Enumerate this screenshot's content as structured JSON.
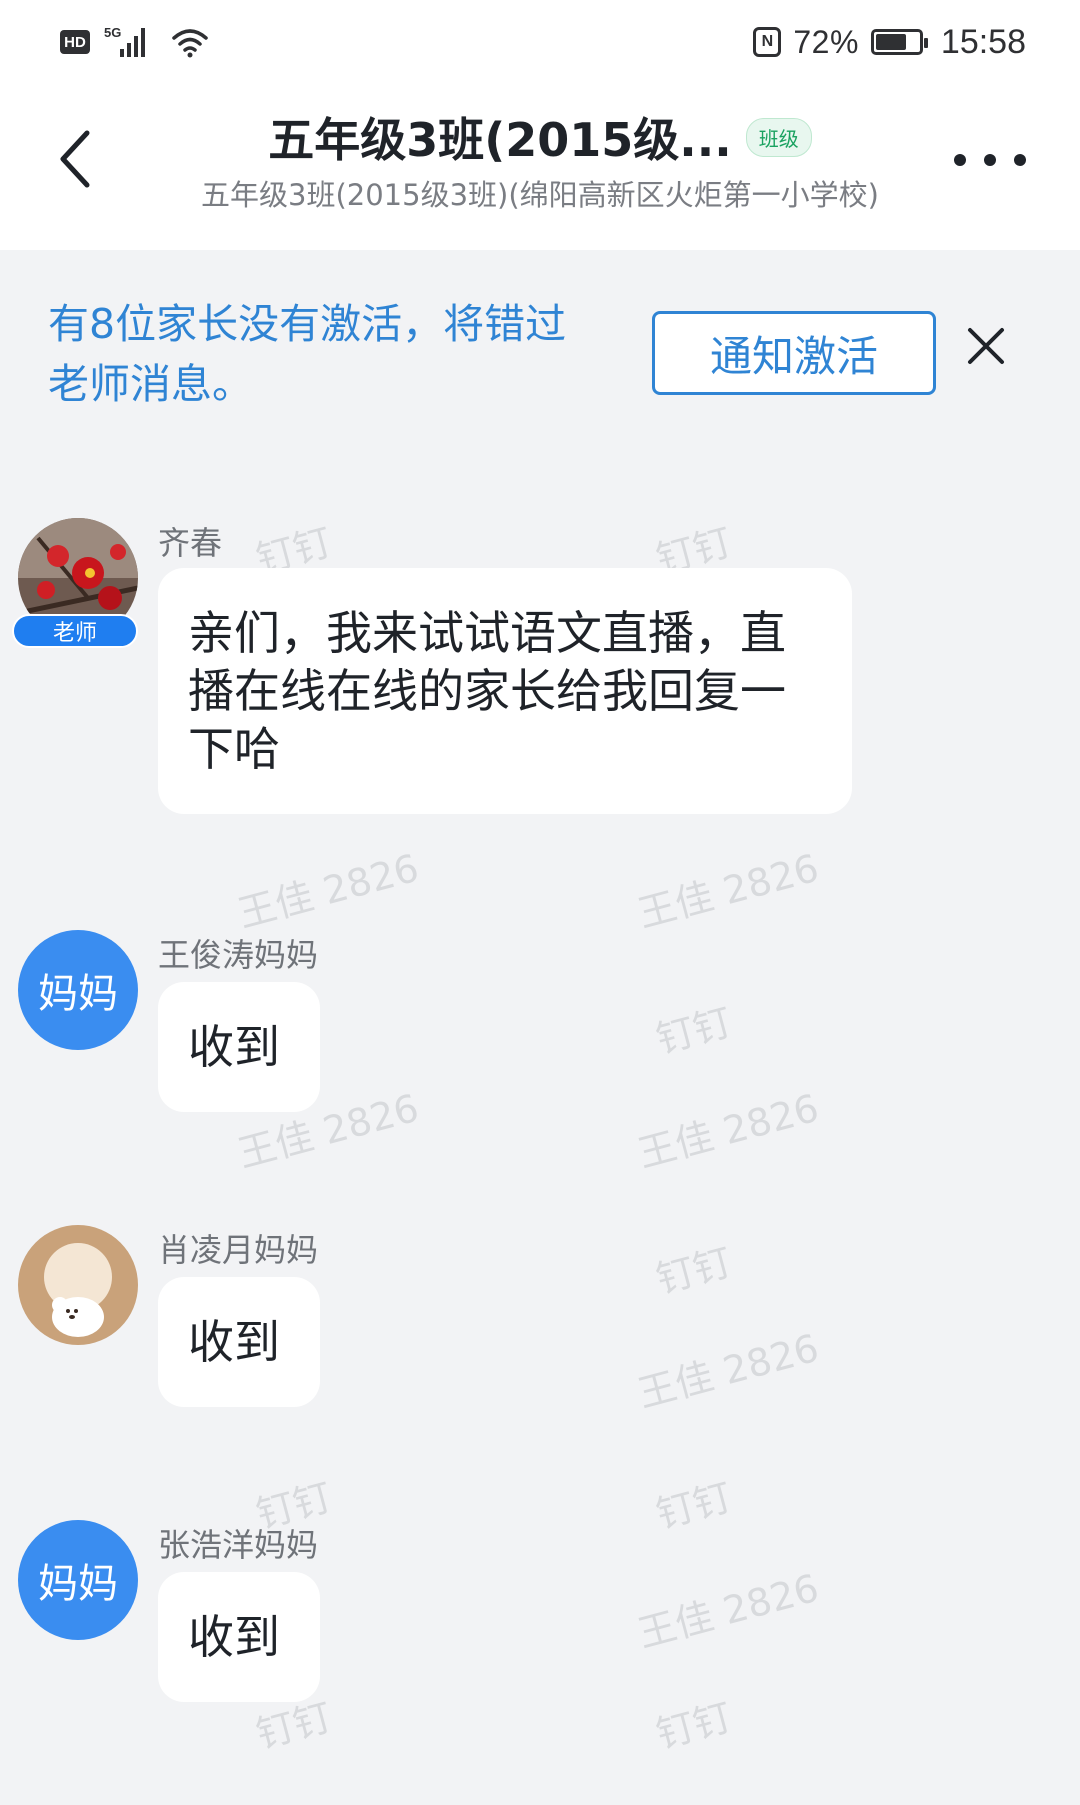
{
  "status_bar": {
    "network_hd": "HD",
    "network_gen": "5G",
    "nfc": "N",
    "battery_percent": "72%",
    "battery_level": 0.72,
    "time": "15:58"
  },
  "header": {
    "title": "五年级3班(2015级...",
    "tag": "班级",
    "subtitle": "五年级3班(2015级3班)(绵阳高新区火炬第一小学校)"
  },
  "banner": {
    "text": "有8位家长没有激活，将错过老师消息。",
    "button_label": "通知激活"
  },
  "watermark": {
    "texts": [
      "钉钉",
      "王佳 2826"
    ]
  },
  "messages": [
    {
      "sender": "齐春",
      "role": "老师",
      "avatar": "plum-blossom-photo",
      "text": "亲们，我来试试语文直播，直播在线在线的家长给我回复一下哈"
    },
    {
      "sender": "王俊涛妈妈",
      "avatar_text": "妈妈",
      "text": "收到"
    },
    {
      "sender": "肖凌月妈妈",
      "avatar": "bear-illustration",
      "text": "收到"
    },
    {
      "sender": "张浩洋妈妈",
      "avatar_text": "妈妈",
      "text": "收到"
    }
  ],
  "colors": {
    "accent": "#2f84d4",
    "avatar_blue": "#3a8df0",
    "badge_green": "#1aa260",
    "background": "#f2f3f5"
  }
}
